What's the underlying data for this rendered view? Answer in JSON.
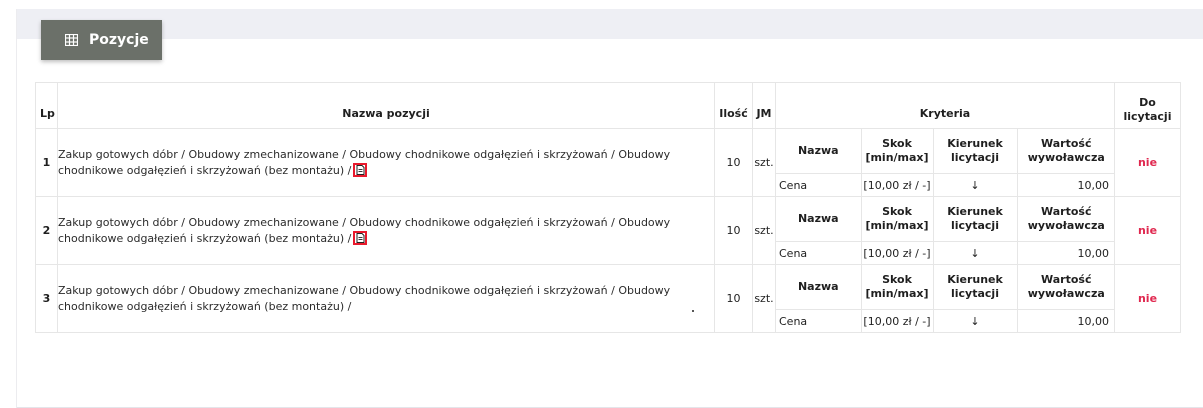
{
  "tab": {
    "label": "Pozycje",
    "icon": "table-grid-icon"
  },
  "table": {
    "headers": {
      "lp": "Lp",
      "name": "Nazwa pozycji",
      "qty": "Ilość",
      "unit": "JM",
      "criteria": "Kryteria",
      "auction": "Do licytacji"
    },
    "criteria_headers": {
      "name": "Nazwa",
      "step": "Skok [min/max]",
      "direction": "Kierunek licytacji",
      "starting_value": "Wartość wywoławcza"
    },
    "rows": [
      {
        "lp": "1",
        "name": "Zakup gotowych dóbr / Obudowy zmechanizowane / Obudowy chodnikowe odgałęzień i skrzyżowań / Obudowy chodnikowe odgałęzień i skrzyżowań (bez montażu) /",
        "has_doc": true,
        "qty": "10",
        "unit": "szt.",
        "crit_name": "Cena",
        "crit_step": "[10,00 zł / -]",
        "crit_direction": "↓",
        "crit_value": "10,00",
        "auction": "nie"
      },
      {
        "lp": "2",
        "name": "Zakup gotowych dóbr / Obudowy zmechanizowane / Obudowy chodnikowe odgałęzień i skrzyżowań / Obudowy chodnikowe odgałęzień i skrzyżowań (bez montażu) /",
        "has_doc": true,
        "qty": "10",
        "unit": "szt.",
        "crit_name": "Cena",
        "crit_step": "[10,00 zł / -]",
        "crit_direction": "↓",
        "crit_value": "10,00",
        "auction": "nie"
      },
      {
        "lp": "3",
        "name": "Zakup gotowych dóbr / Obudowy zmechanizowane / Obudowy chodnikowe odgałęzień i skrzyżowań / Obudowy chodnikowe odgałęzień i skrzyżowań (bez montażu) /",
        "has_doc": false,
        "qty": "10",
        "unit": "szt.",
        "crit_name": "Cena",
        "crit_step": "[10,00 zł / -]",
        "crit_direction": "↓",
        "crit_value": "10,00",
        "auction": "nie"
      }
    ]
  },
  "colors": {
    "tab_bg": "#6b7069",
    "auction_no": "#e0284f",
    "doc_highlight": "#e8192c"
  }
}
